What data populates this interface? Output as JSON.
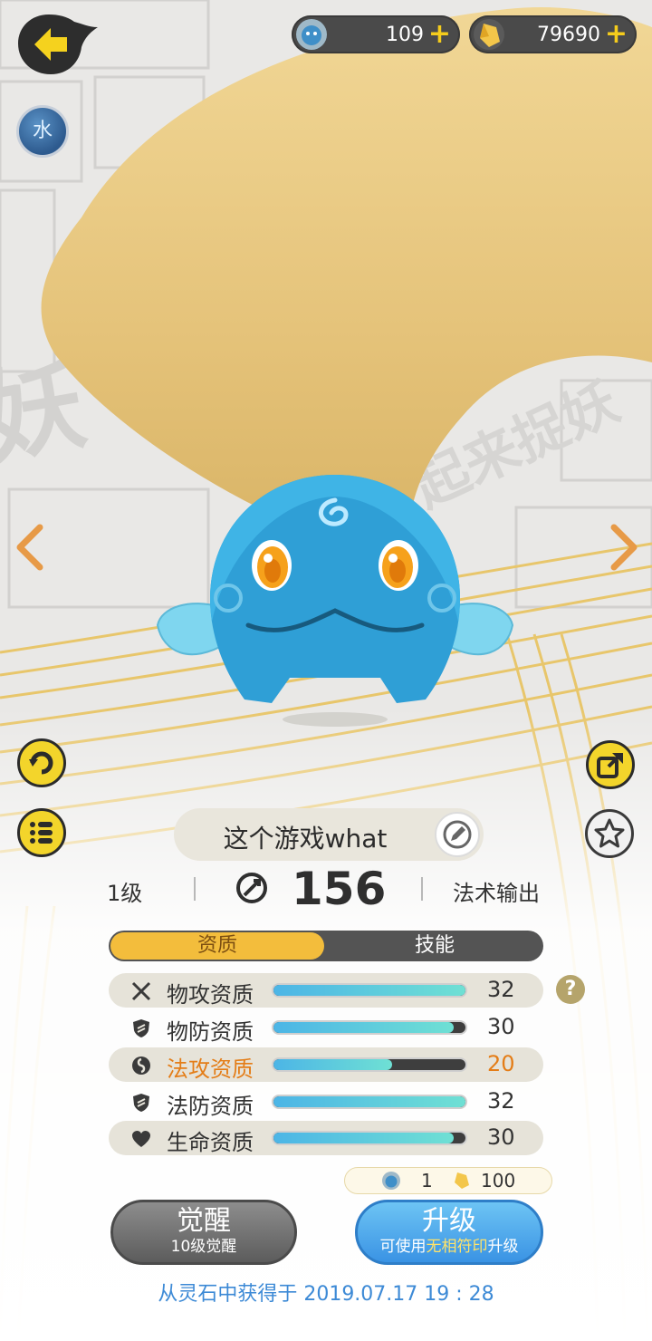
{
  "currency": {
    "gems": "109",
    "gold": "79690",
    "plus": "+"
  },
  "element_badge": "水",
  "pet": {
    "name": "这个游戏what",
    "level": "1级",
    "power": "156",
    "role": "法术输出"
  },
  "tabs": {
    "aptitude": "资质",
    "skills": "技能"
  },
  "attributes": [
    {
      "label": "物攻资质",
      "value": "32",
      "fill": 1.0,
      "icon": "swords-icon"
    },
    {
      "label": "物防资质",
      "value": "30",
      "fill": 0.94,
      "icon": "shield-icon"
    },
    {
      "label": "法攻资质",
      "value": "20",
      "fill": 0.62,
      "icon": "magic-swirl-icon"
    },
    {
      "label": "法防资质",
      "value": "32",
      "fill": 1.0,
      "icon": "shield-icon"
    },
    {
      "label": "生命资质",
      "value": "30",
      "fill": 0.94,
      "icon": "heart-icon"
    }
  ],
  "help": "?",
  "cost": {
    "gems": "1",
    "gold": "100"
  },
  "buttons": {
    "awaken_label": "觉醒",
    "awaken_sub": "10级觉醒",
    "upgrade_label": "升级",
    "upgrade_sub_pre": "可使用",
    "upgrade_sub_highlight": "无相符印",
    "upgrade_sub_post": "升级"
  },
  "acquired": "从灵石中获得于 2019.07.17  19 : 28",
  "background_text": "一起来捉妖",
  "colors": {
    "accent_gold": "#f3bd3c",
    "highlight_orange": "#e47d17",
    "upgrade_blue": "#3a93e4",
    "bar_fill": "#4cb5e6"
  }
}
